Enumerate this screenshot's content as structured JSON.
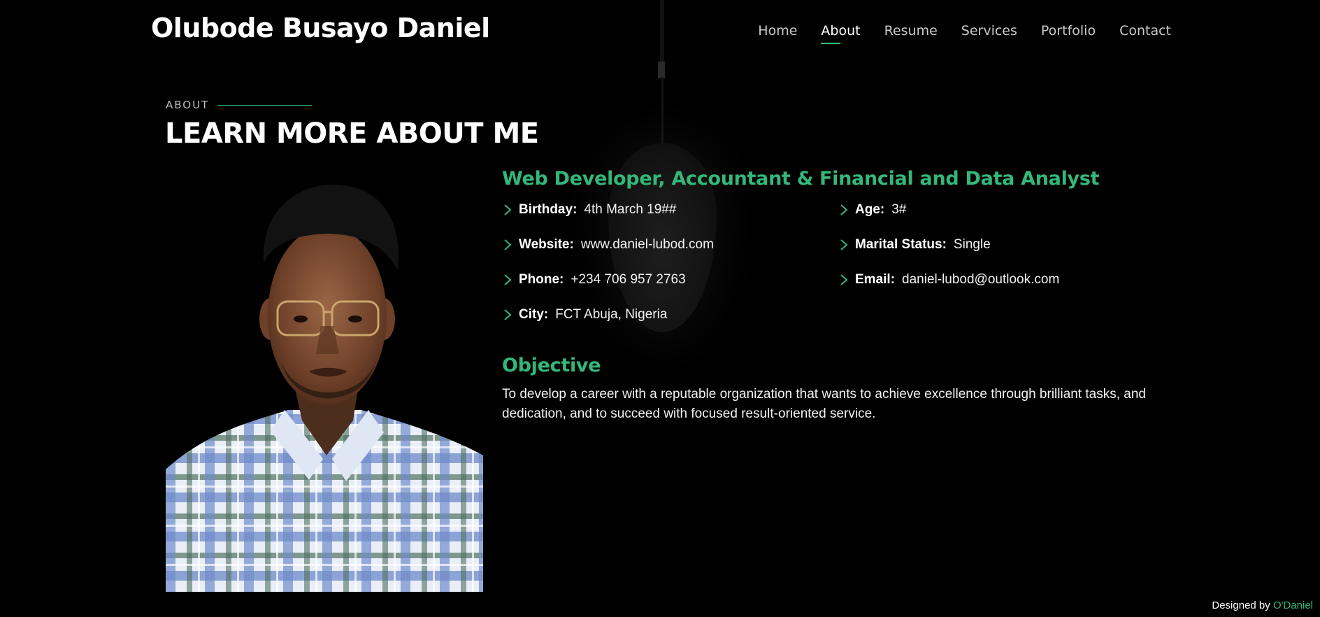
{
  "header": {
    "logo": "Olubode Busayo Daniel",
    "nav": [
      "Home",
      "About",
      "Resume",
      "Services",
      "Portfolio",
      "Contact"
    ],
    "active_nav": "About"
  },
  "section": {
    "label": "ABOUT",
    "title": "LEARN MORE ABOUT ME"
  },
  "profile": {
    "role": "Web Developer, Accountant & Financial and Data Analyst",
    "info_left": [
      {
        "label": "Birthday:",
        "value": "4th March 19##"
      },
      {
        "label": "Website:",
        "value": "www.daniel-lubod.com"
      },
      {
        "label": "Phone:",
        "value": "+234 706 957 2763"
      },
      {
        "label": "City:",
        "value": "FCT Abuja, Nigeria"
      }
    ],
    "info_right": [
      {
        "label": "Age:",
        "value": "3#"
      },
      {
        "label": "Marital Status:",
        "value": "Single"
      },
      {
        "label": "Email:",
        "value": "daniel-lubod@outlook.com"
      }
    ],
    "objective_title": "Objective",
    "objective_text": "To develop a career with a reputable organization that wants to achieve excellence through brilliant tasks, and dedication, and to succeed with focused result-oriented service."
  },
  "footer": {
    "prefix": "Designed by",
    "brand": "O'Daniel"
  },
  "colors": {
    "accent": "#34b77a",
    "background": "#000000"
  },
  "icons": {
    "list_marker": "chevron-right-icon"
  }
}
